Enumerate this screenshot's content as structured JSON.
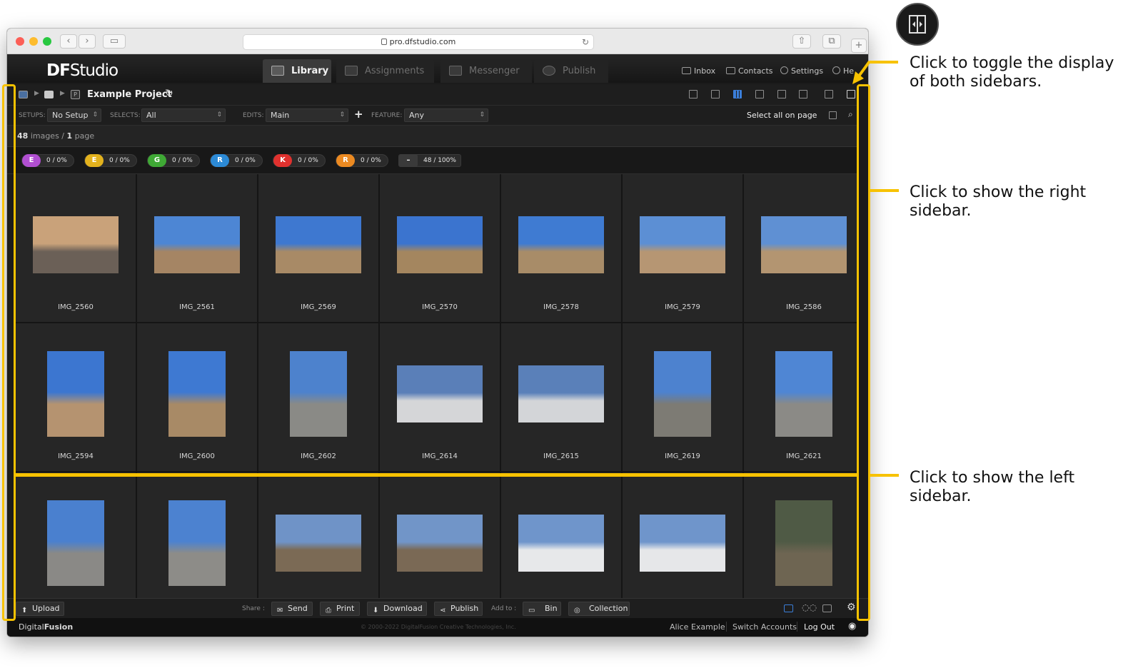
{
  "browser": {
    "url": "pro.dfstudio.com"
  },
  "app": {
    "logo_prefix": "DF",
    "logo_suffix": "Studio",
    "tabs": [
      {
        "label": "Library",
        "active": true
      },
      {
        "label": "Assignments",
        "active": false
      },
      {
        "label": "Messenger",
        "active": false
      },
      {
        "label": "Publish",
        "active": false
      }
    ],
    "header_links": {
      "inbox": "Inbox",
      "contacts": "Contacts",
      "settings": "Settings",
      "help": "He"
    }
  },
  "toolbar": {
    "project_badge": "P",
    "project_title": "Example Project"
  },
  "filters": {
    "setups_label": "SETUPS:",
    "setups_value": "No Setup",
    "selects_label": "SELECTS:",
    "selects_value": "All",
    "edits_label": "EDITS:",
    "edits_value": "Main",
    "feature_label": "FEATURE:",
    "feature_value": "Any",
    "select_all": "Select all on page"
  },
  "counts": {
    "images": "48",
    "images_label": "images /",
    "pages": "1",
    "pages_label": "page"
  },
  "badges": [
    {
      "letter": "E",
      "value": "0 / 0%",
      "color": "#b14fd1"
    },
    {
      "letter": "E",
      "value": "0 / 0%",
      "color": "#e3b21d"
    },
    {
      "letter": "G",
      "value": "0 / 0%",
      "color": "#3fa935"
    },
    {
      "letter": "R",
      "value": "0 / 0%",
      "color": "#2c8ad6"
    },
    {
      "letter": "K",
      "value": "0 / 0%",
      "color": "#e0312e"
    },
    {
      "letter": "R",
      "value": "0 / 0%",
      "color": "#ec8a21"
    },
    {
      "letter": "–",
      "value": "48 / 100%",
      "color": "#3a3a3a"
    }
  ],
  "images": [
    {
      "name": "IMG_2560",
      "orientation": "landscape",
      "palette": [
        "#c9a27a",
        "#6b6057"
      ]
    },
    {
      "name": "IMG_2561",
      "orientation": "landscape",
      "palette": [
        "#4d86d4",
        "#a58564"
      ]
    },
    {
      "name": "IMG_2569",
      "orientation": "landscape",
      "palette": [
        "#3e78d0",
        "#a88a66"
      ]
    },
    {
      "name": "IMG_2570",
      "orientation": "landscape",
      "palette": [
        "#3b74cf",
        "#a4865f"
      ]
    },
    {
      "name": "IMG_2578",
      "orientation": "landscape",
      "palette": [
        "#3f7bd2",
        "#a88c68"
      ]
    },
    {
      "name": "IMG_2579",
      "orientation": "landscape",
      "palette": [
        "#5c8fd4",
        "#b69673"
      ]
    },
    {
      "name": "IMG_2586",
      "orientation": "landscape",
      "palette": [
        "#5f90d3",
        "#b39571"
      ]
    },
    {
      "name": "IMG_2594",
      "orientation": "portrait",
      "palette": [
        "#3c76d0",
        "#b59370"
      ]
    },
    {
      "name": "IMG_2600",
      "orientation": "portrait",
      "palette": [
        "#3e79d2",
        "#a88a66"
      ]
    },
    {
      "name": "IMG_2602",
      "orientation": "portrait",
      "palette": [
        "#4d82cd",
        "#8a8a86"
      ]
    },
    {
      "name": "IMG_2614",
      "orientation": "landscape",
      "palette": [
        "#5a7fb8",
        "#d5d6d8"
      ]
    },
    {
      "name": "IMG_2615",
      "orientation": "landscape",
      "palette": [
        "#5a80b9",
        "#d3d5d8"
      ]
    },
    {
      "name": "IMG_2619",
      "orientation": "portrait",
      "palette": [
        "#4d82cf",
        "#7d7b74"
      ]
    },
    {
      "name": "IMG_2621",
      "orientation": "portrait",
      "palette": [
        "#4f86d4",
        "#8b8a86"
      ]
    },
    {
      "name": "",
      "orientation": "portrait",
      "palette": [
        "#4a80cf",
        "#8a8986"
      ]
    },
    {
      "name": "",
      "orientation": "portrait",
      "palette": [
        "#4c82d0",
        "#8d8c88"
      ]
    },
    {
      "name": "",
      "orientation": "landscape",
      "palette": [
        "#6f93c7",
        "#7b6a55"
      ]
    },
    {
      "name": "",
      "orientation": "landscape",
      "palette": [
        "#7195c8",
        "#7a6955"
      ]
    },
    {
      "name": "",
      "orientation": "landscape",
      "palette": [
        "#6f95cb",
        "#e7e8ea"
      ]
    },
    {
      "name": "",
      "orientation": "landscape",
      "palette": [
        "#6f95cb",
        "#e6e7e9"
      ]
    },
    {
      "name": "",
      "orientation": "portrait",
      "palette": [
        "#4f5a45",
        "#6e6552"
      ]
    }
  ],
  "bottombar": {
    "upload": "Upload",
    "share_label": "Share :",
    "send": "Send",
    "print": "Print",
    "download": "Download",
    "publish": "Publish",
    "add_to_label": "Add to :",
    "bin": "Bin",
    "collection": "Collection"
  },
  "footer": {
    "brand_a": "Digital",
    "brand_b": "Fusion",
    "copyright": "© 2000-2022 DigitalFusion Creative Technologies, Inc.",
    "user": "Alice Example",
    "switch": "Switch Accounts",
    "logout": "Log Out"
  },
  "annotations": {
    "toggle_both": "Click to toggle the display of both sidebars.",
    "show_right": "Click to show the right sidebar.",
    "show_left": "Click to show the left sidebar."
  },
  "colors": {
    "highlight": "#f7c200",
    "accent": "#3b7ed8"
  }
}
